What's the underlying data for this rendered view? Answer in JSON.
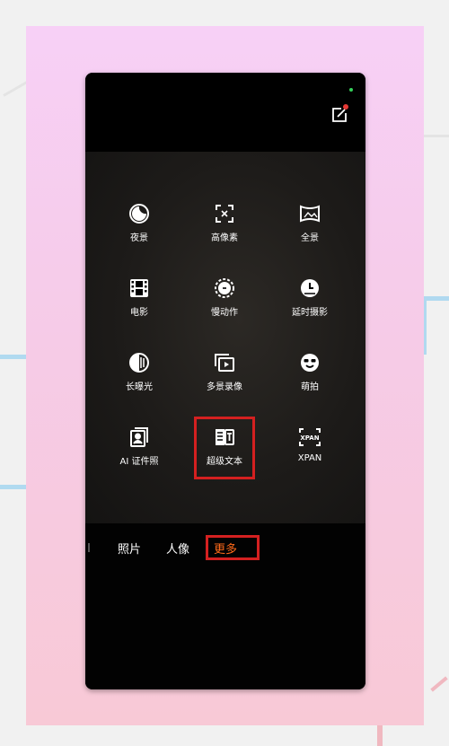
{
  "colors": {
    "accent": "#ff6a1a",
    "highlight_box": "#d42020",
    "notification_dot": "#e53935",
    "status_dot": "#35d05a"
  },
  "modes": [
    {
      "label": "夜景",
      "icon": "night-mode-icon"
    },
    {
      "label": "高像素",
      "icon": "high-pixel-icon"
    },
    {
      "label": "全景",
      "icon": "panorama-icon"
    },
    {
      "label": "电影",
      "icon": "movie-icon"
    },
    {
      "label": "慢动作",
      "icon": "slow-motion-icon"
    },
    {
      "label": "延时摄影",
      "icon": "timelapse-icon"
    },
    {
      "label": "长曝光",
      "icon": "long-exposure-icon"
    },
    {
      "label": "多景录像",
      "icon": "multi-scene-video-icon"
    },
    {
      "label": "萌拍",
      "icon": "cute-face-icon"
    },
    {
      "label": "AI 证件照",
      "icon": "ai-id-photo-icon"
    },
    {
      "label": "超级文本",
      "icon": "super-text-icon"
    },
    {
      "label": "XPAN",
      "icon": "xpan-icon"
    }
  ],
  "xpan_icon_text": "XPAN",
  "tabs": [
    {
      "label": "照片",
      "active": false
    },
    {
      "label": "人像",
      "active": false
    },
    {
      "label": "更多",
      "active": true
    }
  ]
}
